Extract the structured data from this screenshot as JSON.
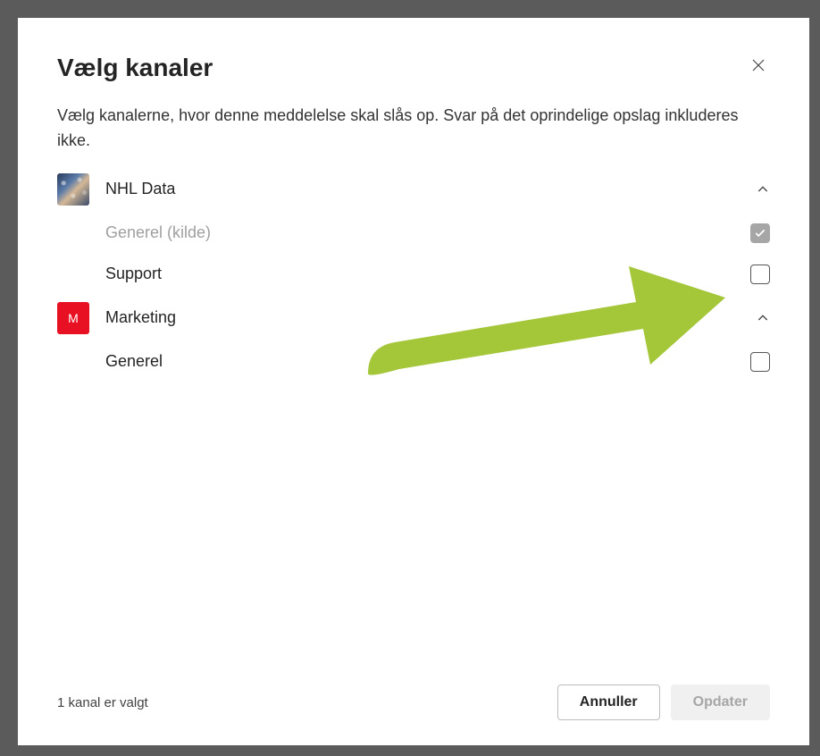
{
  "modal": {
    "title": "Vælg kanaler",
    "description": "Vælg kanalerne, hvor denne meddelelse skal slås op. Svar på det oprindelige opslag inkluderes ikke."
  },
  "teams": [
    {
      "name": "NHL Data",
      "avatar_letter": "",
      "avatar_style": "nhl",
      "expanded": true,
      "channels": [
        {
          "name": "Generel (kilde)",
          "checked": true,
          "disabled": true
        },
        {
          "name": "Support",
          "checked": false,
          "disabled": false
        }
      ]
    },
    {
      "name": "Marketing",
      "avatar_letter": "M",
      "avatar_style": "marketing",
      "expanded": true,
      "channels": [
        {
          "name": "Generel",
          "checked": false,
          "disabled": false
        }
      ]
    }
  ],
  "footer": {
    "status": "1 kanal er valgt",
    "cancel_label": "Annuller",
    "update_label": "Opdater"
  },
  "colors": {
    "arrow": "#a4c639"
  }
}
